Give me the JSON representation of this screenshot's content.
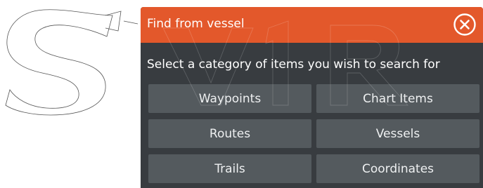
{
  "dialog": {
    "title": "Find from vessel",
    "close_icon": "close-circle-icon",
    "prompt": "Select a category of items you wish to search for",
    "categories": [
      {
        "label": "Waypoints"
      },
      {
        "label": "Chart Items"
      },
      {
        "label": "Routes"
      },
      {
        "label": "Vessels"
      },
      {
        "label": "Trails"
      },
      {
        "label": "Coordinates"
      }
    ]
  },
  "colors": {
    "titlebar": "#e3582b",
    "dialog_bg": "#383c40",
    "button_bg": "#545a5e",
    "text": "#ffffff"
  }
}
